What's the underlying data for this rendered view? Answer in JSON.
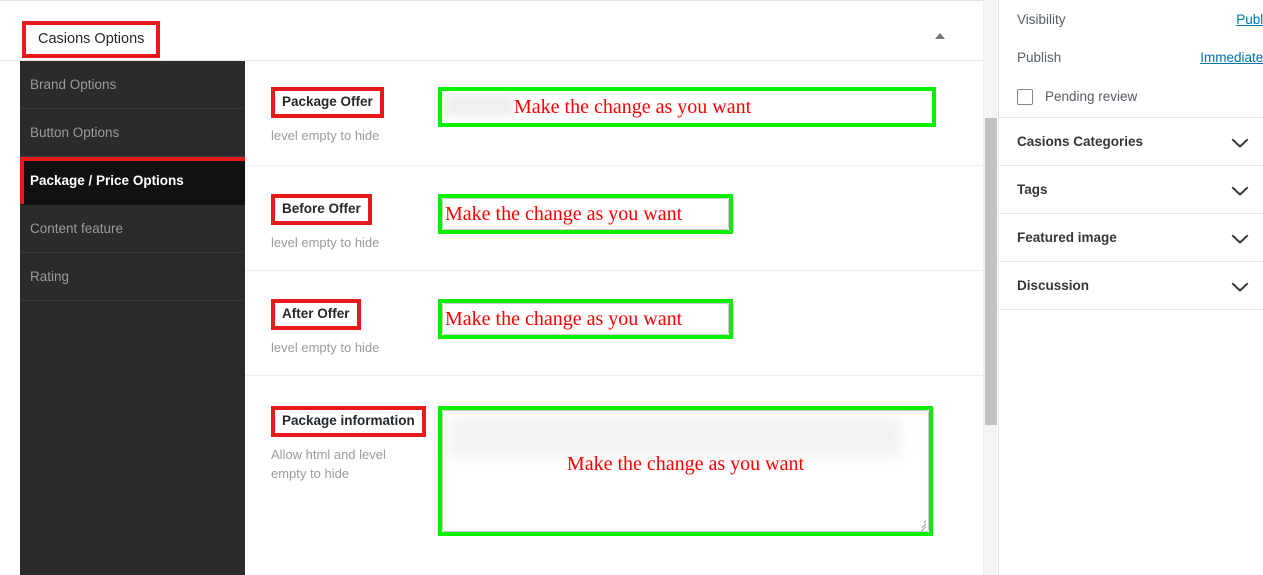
{
  "metabox": {
    "title": "Casions Options",
    "collapse_icon": "chevron-up-icon",
    "tabs": [
      {
        "label": "Brand Options",
        "active": false
      },
      {
        "label": "Button Options",
        "active": false
      },
      {
        "label": "Package / Price Options",
        "active": true
      },
      {
        "label": "Content feature",
        "active": false
      },
      {
        "label": "Rating",
        "active": false
      }
    ],
    "fields": [
      {
        "label": "Package Offer",
        "helper": "level empty to hide",
        "control": "text",
        "value": "Make the change as you want"
      },
      {
        "label": "Before Offer",
        "helper": "level empty to hide",
        "control": "text",
        "value": "Make the change as you want"
      },
      {
        "label": "After Offer",
        "helper": "level empty to hide",
        "control": "text",
        "value": "Make the change as you want"
      },
      {
        "label": "Package information",
        "helper": "Allow html and level empty to hide",
        "control": "textarea",
        "value": "Make the change as you want"
      }
    ]
  },
  "sidebar": {
    "visibility": {
      "label": "Visibility",
      "value": "Public"
    },
    "publish": {
      "label": "Publish",
      "value": "Immediately"
    },
    "pending": {
      "label": "Pending review",
      "checked": false,
      "icon": "checkbox-icon"
    },
    "panels": [
      {
        "label": "Casions Categories",
        "icon": "chevron-down-icon"
      },
      {
        "label": "Tags",
        "icon": "chevron-down-icon"
      },
      {
        "label": "Featured image",
        "icon": "chevron-down-icon"
      },
      {
        "label": "Discussion",
        "icon": "chevron-down-icon"
      }
    ]
  },
  "colors": {
    "annotation_box": "#e8191b",
    "highlight_box": "#0bf000",
    "annotation_text": "#ff0000",
    "link": "#0073aa",
    "tab_bg": "#2b2b2b",
    "tab_active_bg": "#111111"
  }
}
